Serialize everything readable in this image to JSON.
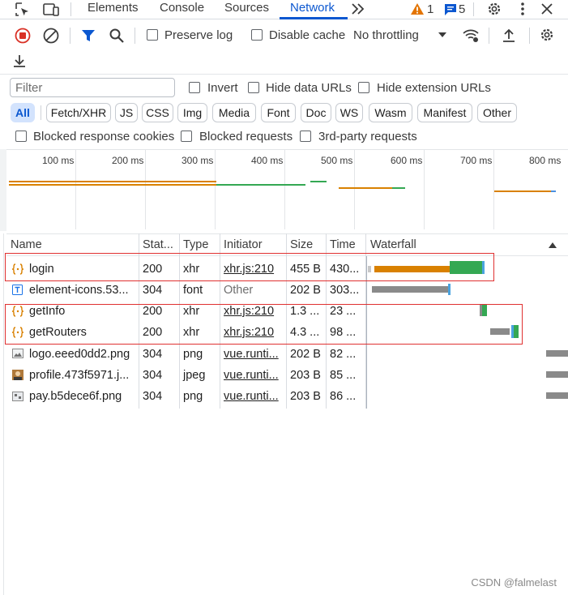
{
  "tabs": [
    "Elements",
    "Console",
    "Sources",
    "Network"
  ],
  "active_tab": "Network",
  "badges": {
    "warnings": "1",
    "messages": "5"
  },
  "toolbar": {
    "preserve_log": "Preserve log",
    "disable_cache": "Disable cache",
    "throttling": "No throttling"
  },
  "filter": {
    "placeholder": "Filter",
    "invert": "Invert",
    "hide_data_urls": "Hide data URLs",
    "hide_extension_urls": "Hide extension URLs"
  },
  "type_filters": [
    "All",
    "Fetch/XHR",
    "JS",
    "CSS",
    "Img",
    "Media",
    "Font",
    "Doc",
    "WS",
    "Wasm",
    "Manifest",
    "Other"
  ],
  "active_type_filter": "All",
  "extra_filters": [
    "Blocked response cookies",
    "Blocked requests",
    "3rd-party requests"
  ],
  "overview_ticks": [
    "100 ms",
    "200 ms",
    "300 ms",
    "400 ms",
    "500 ms",
    "600 ms",
    "700 ms",
    "800 ms"
  ],
  "columns": [
    "Name",
    "Stat...",
    "Type",
    "Initiator",
    "Size",
    "Time",
    "Waterfall"
  ],
  "rows": [
    {
      "name": "login",
      "status": "200",
      "type": "xhr",
      "initiator": "xhr.js:210",
      "size": "455 B",
      "time": "430...",
      "icon": "xhr-icon"
    },
    {
      "name": "element-icons.53...",
      "status": "304",
      "type": "font",
      "initiator": "Other",
      "size": "202 B",
      "time": "303...",
      "icon": "font-icon"
    },
    {
      "name": "getInfo",
      "status": "200",
      "type": "xhr",
      "initiator": "xhr.js:210",
      "size": "1.3 ...",
      "time": "23 ...",
      "icon": "xhr-icon"
    },
    {
      "name": "getRouters",
      "status": "200",
      "type": "xhr",
      "initiator": "xhr.js:210",
      "size": "4.3 ...",
      "time": "98 ...",
      "icon": "xhr-icon"
    },
    {
      "name": "logo.eeed0dd2.png",
      "status": "304",
      "type": "png",
      "initiator": "vue.runti...",
      "size": "202 B",
      "time": "82 ...",
      "icon": "image-icon"
    },
    {
      "name": "profile.473f5971.j...",
      "status": "304",
      "type": "jpeg",
      "initiator": "vue.runti...",
      "size": "203 B",
      "time": "85 ...",
      "icon": "photo-icon"
    },
    {
      "name": "pay.b5dece6f.png",
      "status": "304",
      "type": "png",
      "initiator": "vue.runti...",
      "size": "203 B",
      "time": "86 ...",
      "icon": "image-icon"
    }
  ],
  "watermark": "CSDN @falmelast",
  "colors": {
    "accent": "#0b57d0",
    "waiting": "#d98100",
    "download": "#34a853",
    "queued": "#8a8a8a",
    "highlight_box": "#e03131"
  }
}
